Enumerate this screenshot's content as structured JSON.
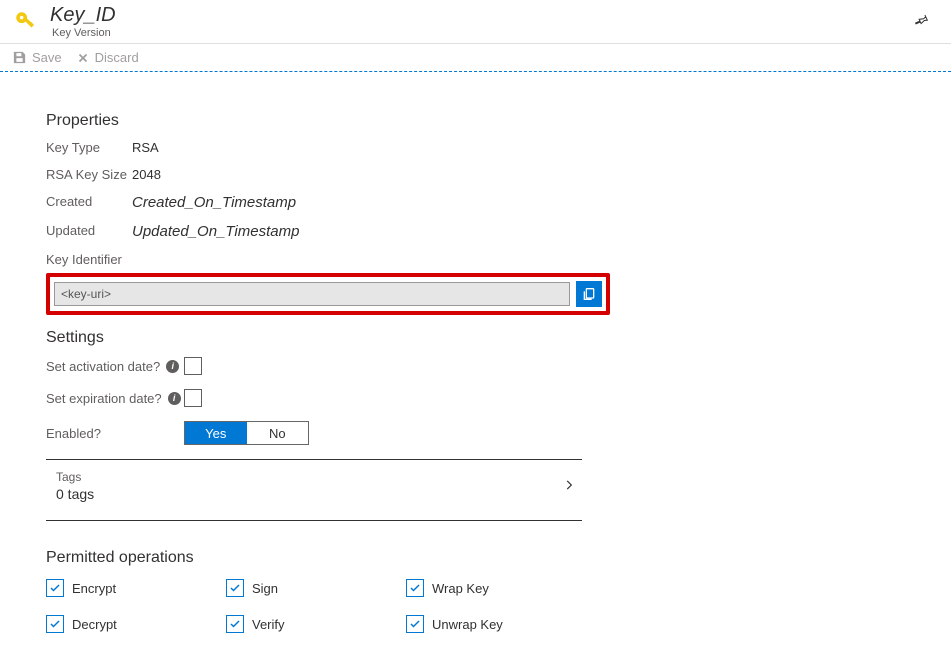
{
  "header": {
    "title": "Key_ID",
    "subtitle": "Key Version"
  },
  "toolbar": {
    "save_label": "Save",
    "discard_label": "Discard"
  },
  "sections": {
    "properties": "Properties",
    "settings": "Settings",
    "permitted": "Permitted operations"
  },
  "properties": {
    "key_type_label": "Key Type",
    "key_type_value": "RSA",
    "rsa_size_label": "RSA Key Size",
    "rsa_size_value": "2048",
    "created_label": "Created",
    "created_value": "Created_On_Timestamp",
    "updated_label": "Updated",
    "updated_value": "Updated_On_Timestamp",
    "key_identifier_label": "Key Identifier",
    "key_uri_value": "<key-uri>"
  },
  "settings": {
    "activation_label": "Set activation date?",
    "expiration_label": "Set expiration date?",
    "enabled_label": "Enabled?",
    "enabled_yes": "Yes",
    "enabled_no": "No",
    "tags_label": "Tags",
    "tags_count": "0 tags"
  },
  "operations": {
    "encrypt": "Encrypt",
    "sign": "Sign",
    "wrap": "Wrap Key",
    "decrypt": "Decrypt",
    "verify": "Verify",
    "unwrap": "Unwrap Key"
  }
}
